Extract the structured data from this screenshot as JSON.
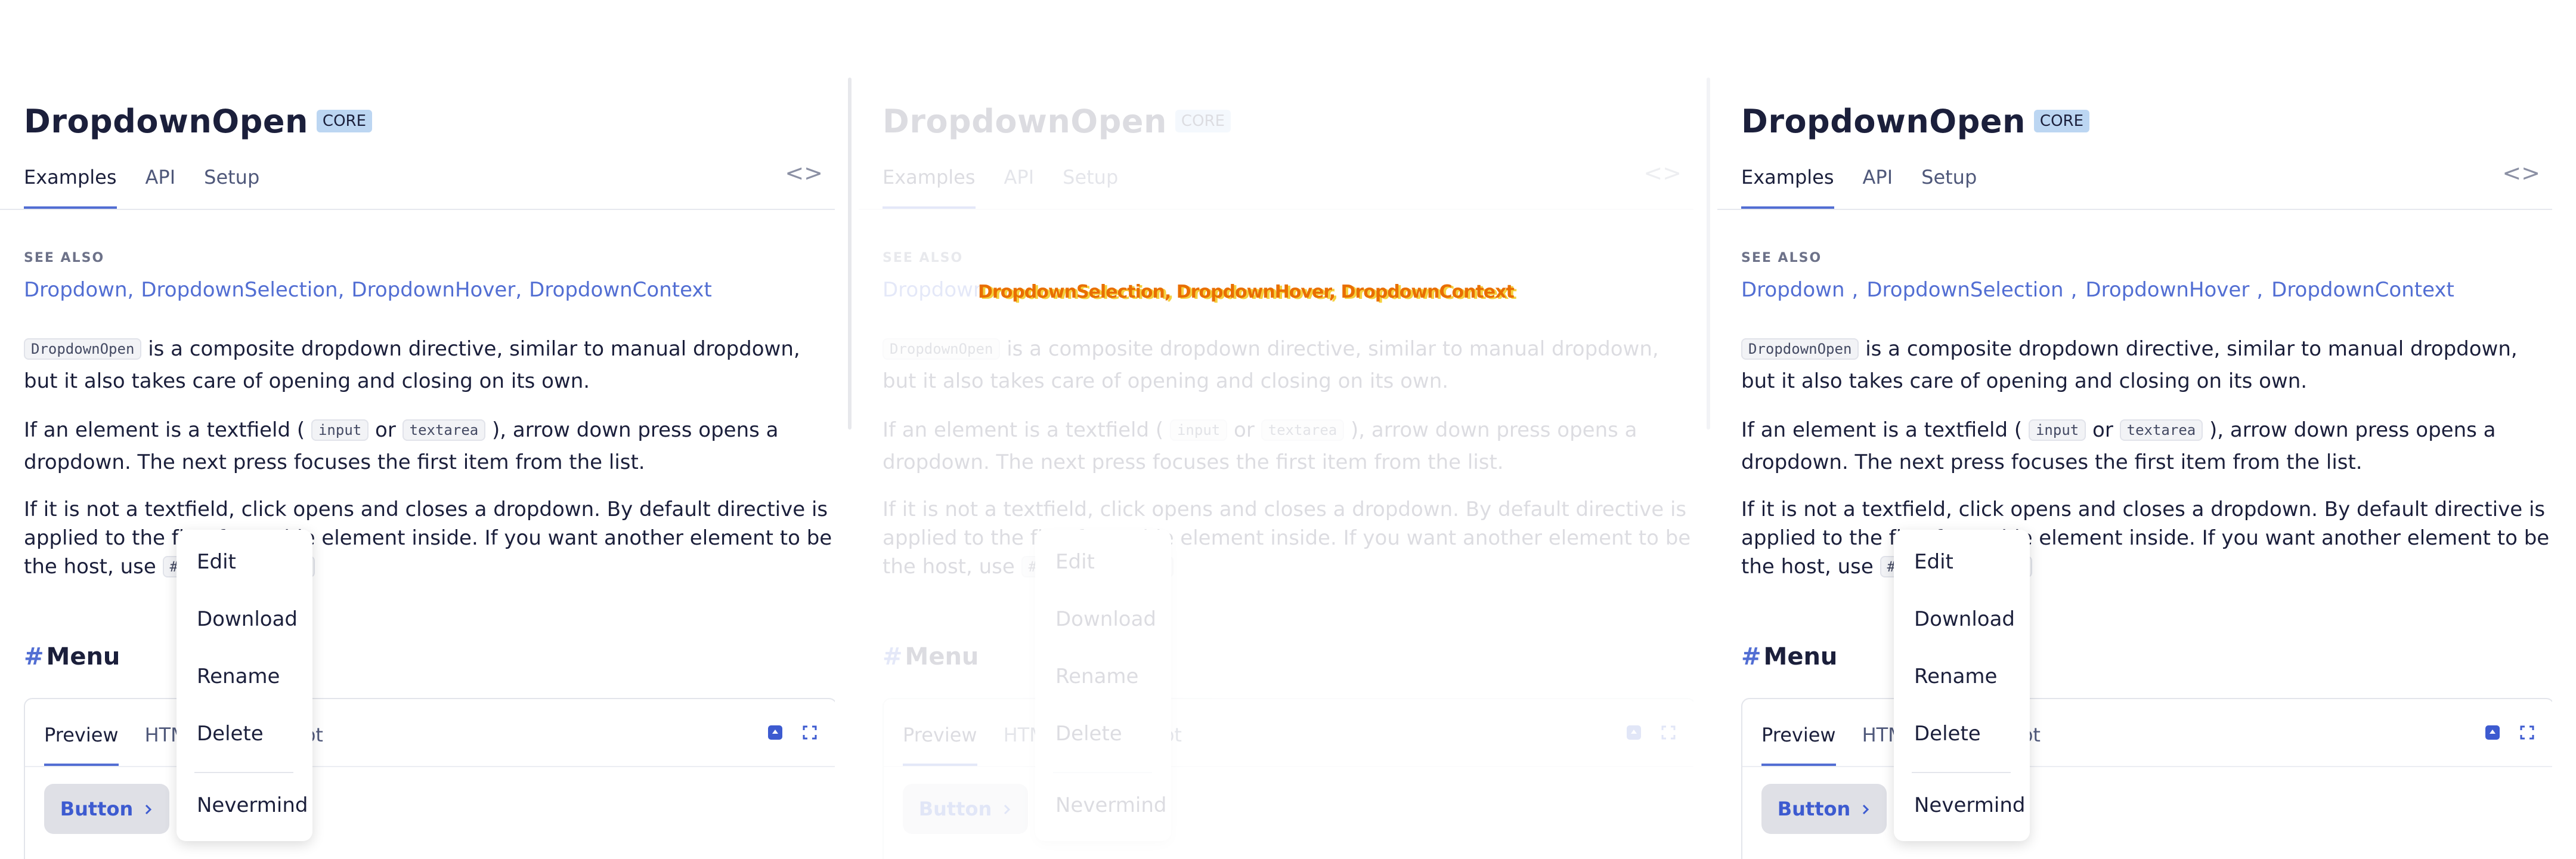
{
  "page": {
    "title": "DropdownOpen",
    "badge": "CORE",
    "tabs": [
      "Examples",
      "API",
      "Setup"
    ],
    "code_toggle_icon": "code-brackets-icon"
  },
  "see_also": {
    "label": "SEE ALSO",
    "links": [
      "Dropdown",
      "DropdownSelection",
      "DropdownHover",
      "DropdownContext"
    ],
    "separator": ","
  },
  "paragraphs": {
    "p1_code": "DropdownOpen",
    "p1_text": "is a composite dropdown directive, similar to manual dropdown, but it also takes care of opening and closing on its own.",
    "p2_start": "If an element is a textfield (",
    "p2_code1": "input",
    "p2_or": "or",
    "p2_code2": "textarea",
    "p2_end": "), arrow down press opens a dropdown. The next press focuses the first item from the list.",
    "p3_text": "If it is not a textfield, click opens and closes a dropdown. By default directive is applied to the first focusable element inside. If you want another element to be the host, use",
    "p3_code": "#tuiDropdownHost"
  },
  "section": {
    "hash": "#",
    "title": "Menu"
  },
  "demo": {
    "tabs": [
      "Preview",
      "HTML",
      "TypeScript"
    ],
    "icons": [
      "stackblitz-icon",
      "fullscreen-icon"
    ],
    "button_label": "Button",
    "button_icon": "chevron-right-icon"
  },
  "menu": {
    "items": [
      "Edit",
      "Download",
      "Rename",
      "Delete"
    ],
    "footer_item": "Nevermind"
  },
  "overlay": {
    "text": "DropdownSelection, DropdownHover, DropdownContext"
  },
  "colors": {
    "accent": "#526ed3",
    "badge_bg": "#bcd6f2",
    "text": "#1b1f3b",
    "overlay": "#e96e00"
  }
}
